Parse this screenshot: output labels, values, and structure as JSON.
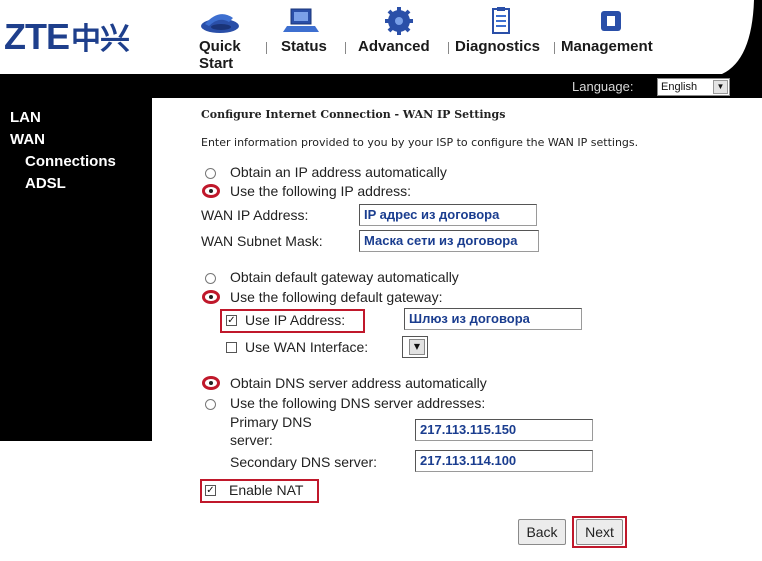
{
  "header": {
    "logo_text": "ZTE",
    "logo_cn": "中兴",
    "nav": [
      {
        "label": "Quick Start",
        "icon": "quick-start-icon"
      },
      {
        "label": "Status",
        "icon": "status-icon"
      },
      {
        "label": "Advanced",
        "icon": "advanced-icon"
      },
      {
        "label": "Diagnostics",
        "icon": "diagnostics-icon"
      },
      {
        "label": "Management",
        "icon": "management-icon"
      }
    ],
    "language_label": "Language:",
    "language_value": "English"
  },
  "sidebar": {
    "items": [
      {
        "label": "LAN"
      },
      {
        "label": "WAN"
      },
      {
        "label": "Connections"
      },
      {
        "label": "ADSL"
      }
    ]
  },
  "content": {
    "title": "Configure Internet Connection - WAN IP Settings",
    "description": "Enter information provided to you by your ISP to configure the WAN IP settings.",
    "ip_section": {
      "opt_auto": "Obtain an IP address automatically",
      "opt_manual": "Use the following IP address:",
      "wan_ip_label": "WAN IP Address:",
      "wan_ip_value": "IP адрес из договора",
      "mask_label": "WAN Subnet Mask:",
      "mask_value": "Маска сети из договора"
    },
    "gateway_section": {
      "opt_auto": "Obtain default gateway automatically",
      "opt_manual": "Use the following default gateway:",
      "use_ip_label": "Use IP Address:",
      "use_ip_value": "Шлюз из договора",
      "use_wan_label": "Use WAN Interface:"
    },
    "dns_section": {
      "opt_auto": "Obtain DNS server address automatically",
      "opt_manual": "Use the following DNS server addresses:",
      "primary_label_1": "Primary DNS",
      "primary_label_2": "server:",
      "primary_value": "217.113.115.150",
      "secondary_label": "Secondary DNS server:",
      "secondary_value": "217.113.114.100"
    },
    "nat_label": "Enable NAT",
    "back_label": "Back",
    "next_label": "Next"
  },
  "colors": {
    "highlight": "#c0182b",
    "value_text": "#1a3d8f",
    "brand": "#1e3f8c"
  }
}
